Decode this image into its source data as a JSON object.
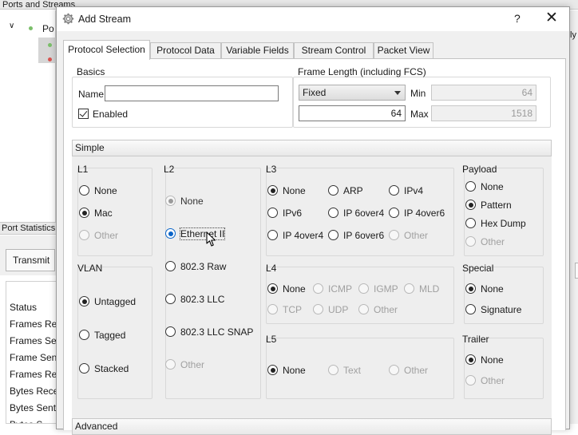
{
  "background": {
    "header_title": "Ports and Streams",
    "tree_item": "Po",
    "stats_header": "Port Statistics",
    "transmit_button": "Transmit",
    "stat_rows": [
      "Status",
      "Frames Re",
      "Frames Sen",
      "Frame Sen",
      "Frames Rec",
      "Bytes Rece",
      "Bytes Sent",
      "Bytes S"
    ],
    "right_label": "ly"
  },
  "dialog": {
    "title": "Add Stream",
    "help": "?",
    "close": "✕"
  },
  "tabs": [
    "Protocol Selection",
    "Protocol Data",
    "Variable Fields",
    "Stream Control",
    "Packet View"
  ],
  "basics": {
    "title": "Basics",
    "name_label": "Name",
    "name_value": "",
    "enabled_label": "Enabled",
    "enabled": true
  },
  "frame_length": {
    "title": "Frame Length (including FCS)",
    "mode": "Fixed",
    "value": "64",
    "min_label": "Min",
    "min_value": "64",
    "max_label": "Max",
    "max_value": "1518"
  },
  "simple_label": "Simple",
  "advanced_label": "Advanced",
  "l1": {
    "title": "L1",
    "options": [
      "None",
      "Mac",
      "Other"
    ]
  },
  "vlan": {
    "title": "VLAN",
    "options": [
      "Untagged",
      "Tagged",
      "Stacked"
    ]
  },
  "l2": {
    "title": "L2",
    "options": [
      "None",
      "Ethernet II",
      "802.3 Raw",
      "802.3 LLC",
      "802.3 LLC SNAP",
      "Other"
    ]
  },
  "l3": {
    "title": "L3",
    "options": [
      "None",
      "ARP",
      "IPv4",
      "IPv6",
      "IP 6over4",
      "IP 4over6",
      "IP 4over4",
      "IP 6over6",
      "Other"
    ]
  },
  "l4": {
    "title": "L4",
    "options": [
      "None",
      "ICMP",
      "IGMP",
      "MLD",
      "TCP",
      "UDP",
      "Other"
    ]
  },
  "l5": {
    "title": "L5",
    "options": [
      "None",
      "Text",
      "Other"
    ]
  },
  "payload": {
    "title": "Payload",
    "options": [
      "None",
      "Pattern",
      "Hex Dump",
      "Other"
    ]
  },
  "special": {
    "title": "Special",
    "options": [
      "None",
      "Signature"
    ]
  },
  "trailer": {
    "title": "Trailer",
    "options": [
      "None",
      "Other"
    ]
  }
}
